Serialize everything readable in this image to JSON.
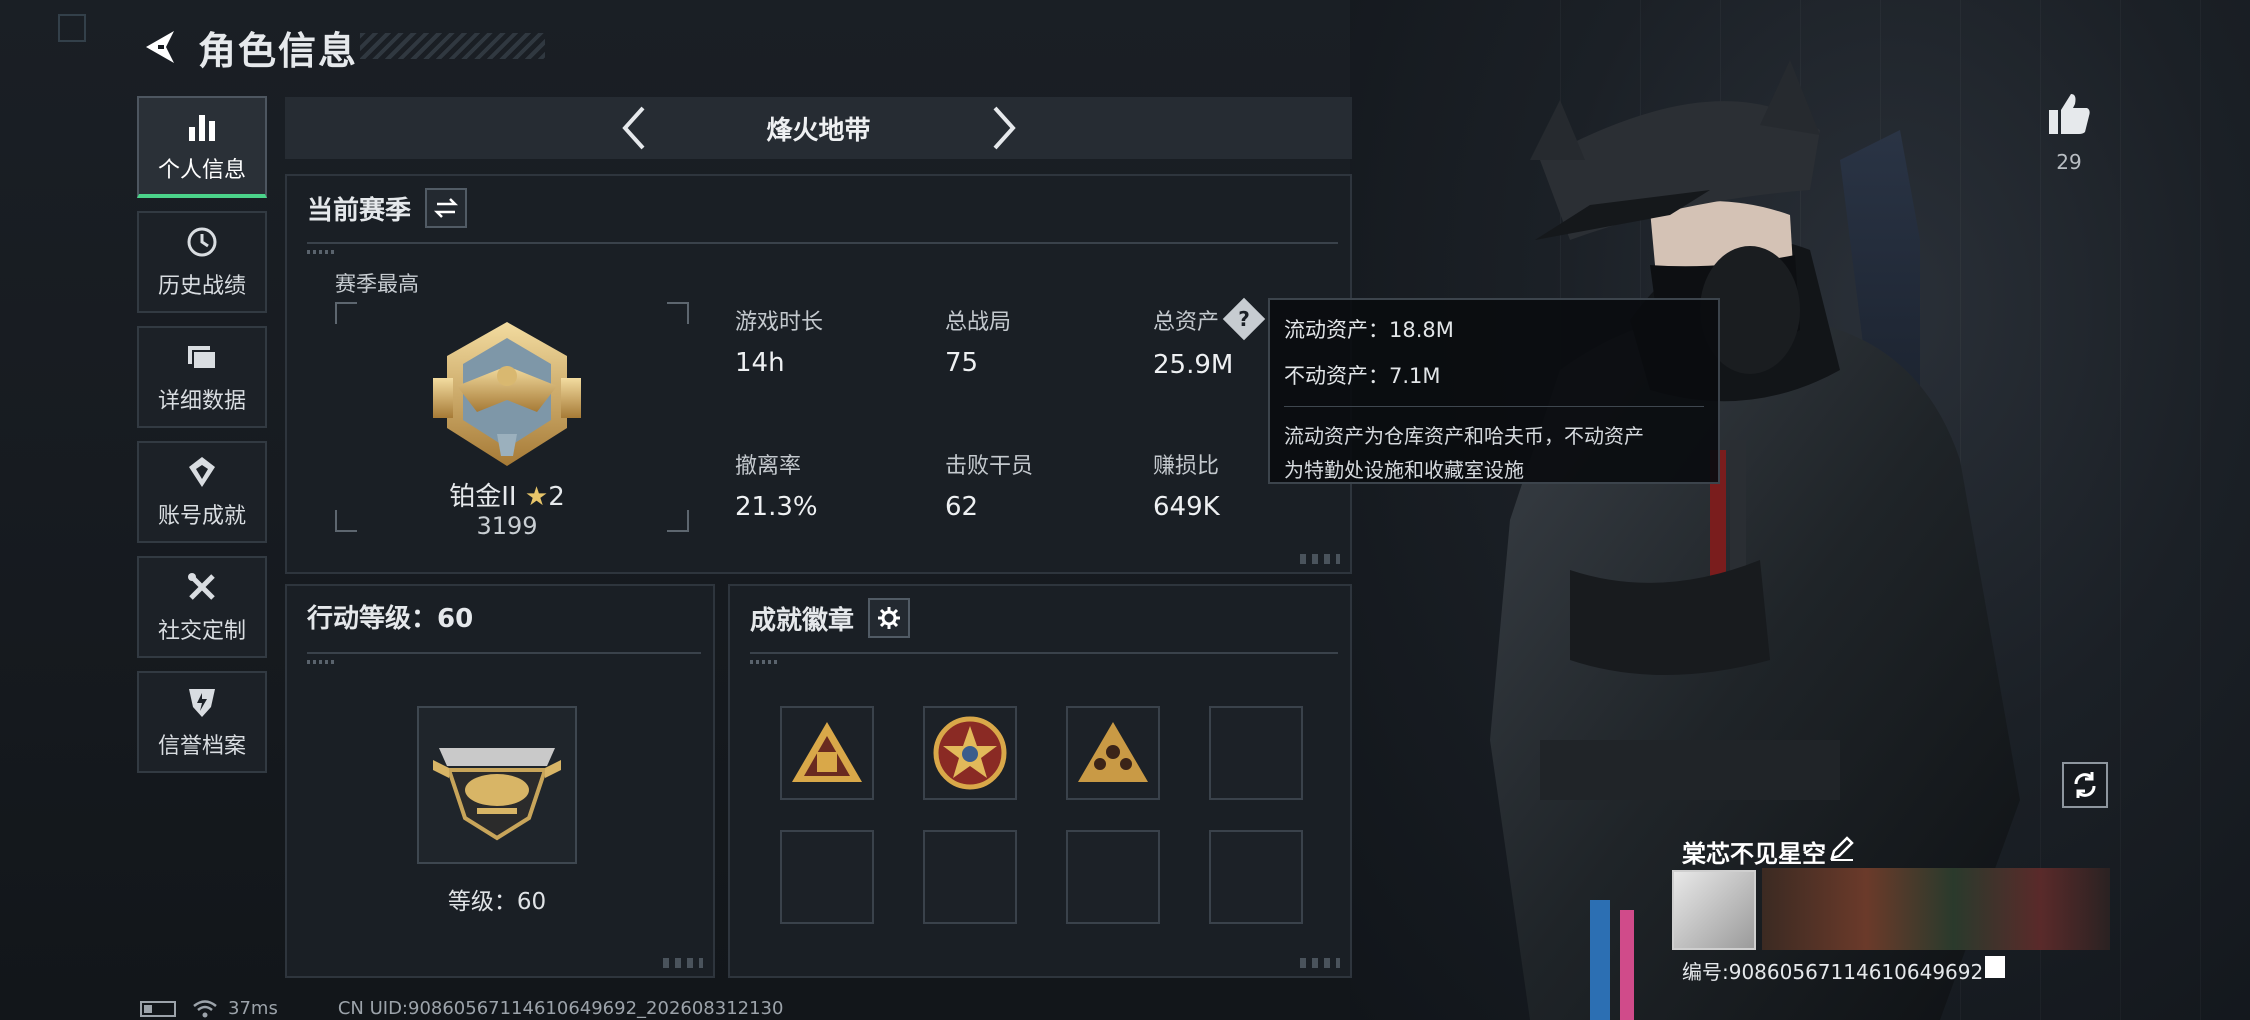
{
  "header": {
    "title": "角色信息"
  },
  "nav": {
    "items": [
      {
        "label": "个人信息",
        "icon": "bar-chart-icon",
        "active": true
      },
      {
        "label": "历史战绩",
        "icon": "history-icon",
        "active": false
      },
      {
        "label": "详细数据",
        "icon": "folder-icon",
        "active": false
      },
      {
        "label": "账号成就",
        "icon": "achievement-icon",
        "active": false
      },
      {
        "label": "社交定制",
        "icon": "tools-icon",
        "active": false
      },
      {
        "label": "信誉档案",
        "icon": "shield-icon",
        "active": false
      }
    ]
  },
  "mode": {
    "title": "烽火地带"
  },
  "season": {
    "title": "当前赛季",
    "best_label": "赛季最高",
    "rank_name": "铂金II",
    "rank_stars": "2",
    "rank_score": "3199",
    "stats": [
      {
        "label": "游戏时长",
        "value": "14h"
      },
      {
        "label": "总战局",
        "value": "75"
      },
      {
        "label": "总资产",
        "value": "25.9M"
      },
      {
        "label": "撤离率",
        "value": "21.3%"
      },
      {
        "label": "击败干员",
        "value": "62"
      },
      {
        "label": "赚损比",
        "value": "649K"
      }
    ]
  },
  "tooltip": {
    "liquid": "流动资产：18.8M",
    "fixed": "不动资产：7.1M",
    "desc_line1": "流动资产为仓库资产和哈夫币，不动资产",
    "desc_line2": "为特勤处设施和收藏室设施"
  },
  "level": {
    "title": "行动等级：60",
    "text": "等级：60"
  },
  "badges": {
    "title": "成就徽章"
  },
  "profile": {
    "likes": "29",
    "name": "棠芯不见星空",
    "id": "编号:9086056711461064​9692"
  },
  "status": {
    "ping": "37ms",
    "uid": "CN UID:9086056711461064​9692_202608312130"
  },
  "colors": {
    "accent": "#4bd38a",
    "panel": "#1a1f25",
    "border": "#2e353d"
  }
}
